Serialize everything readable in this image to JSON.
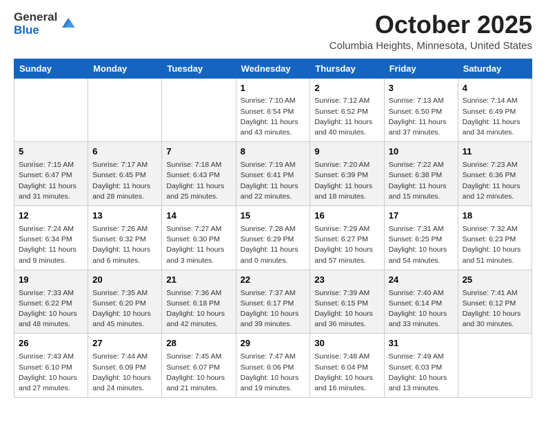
{
  "header": {
    "logo_general": "General",
    "logo_blue": "Blue",
    "month": "October 2025",
    "location": "Columbia Heights, Minnesota, United States"
  },
  "days_of_week": [
    "Sunday",
    "Monday",
    "Tuesday",
    "Wednesday",
    "Thursday",
    "Friday",
    "Saturday"
  ],
  "weeks": [
    [
      {
        "day": "",
        "info": ""
      },
      {
        "day": "",
        "info": ""
      },
      {
        "day": "",
        "info": ""
      },
      {
        "day": "1",
        "info": "Sunrise: 7:10 AM\nSunset: 6:54 PM\nDaylight: 11 hours and 43 minutes."
      },
      {
        "day": "2",
        "info": "Sunrise: 7:12 AM\nSunset: 6:52 PM\nDaylight: 11 hours and 40 minutes."
      },
      {
        "day": "3",
        "info": "Sunrise: 7:13 AM\nSunset: 6:50 PM\nDaylight: 11 hours and 37 minutes."
      },
      {
        "day": "4",
        "info": "Sunrise: 7:14 AM\nSunset: 6:49 PM\nDaylight: 11 hours and 34 minutes."
      }
    ],
    [
      {
        "day": "5",
        "info": "Sunrise: 7:15 AM\nSunset: 6:47 PM\nDaylight: 11 hours and 31 minutes."
      },
      {
        "day": "6",
        "info": "Sunrise: 7:17 AM\nSunset: 6:45 PM\nDaylight: 11 hours and 28 minutes."
      },
      {
        "day": "7",
        "info": "Sunrise: 7:18 AM\nSunset: 6:43 PM\nDaylight: 11 hours and 25 minutes."
      },
      {
        "day": "8",
        "info": "Sunrise: 7:19 AM\nSunset: 6:41 PM\nDaylight: 11 hours and 22 minutes."
      },
      {
        "day": "9",
        "info": "Sunrise: 7:20 AM\nSunset: 6:39 PM\nDaylight: 11 hours and 18 minutes."
      },
      {
        "day": "10",
        "info": "Sunrise: 7:22 AM\nSunset: 6:38 PM\nDaylight: 11 hours and 15 minutes."
      },
      {
        "day": "11",
        "info": "Sunrise: 7:23 AM\nSunset: 6:36 PM\nDaylight: 11 hours and 12 minutes."
      }
    ],
    [
      {
        "day": "12",
        "info": "Sunrise: 7:24 AM\nSunset: 6:34 PM\nDaylight: 11 hours and 9 minutes."
      },
      {
        "day": "13",
        "info": "Sunrise: 7:26 AM\nSunset: 6:32 PM\nDaylight: 11 hours and 6 minutes."
      },
      {
        "day": "14",
        "info": "Sunrise: 7:27 AM\nSunset: 6:30 PM\nDaylight: 11 hours and 3 minutes."
      },
      {
        "day": "15",
        "info": "Sunrise: 7:28 AM\nSunset: 6:29 PM\nDaylight: 11 hours and 0 minutes."
      },
      {
        "day": "16",
        "info": "Sunrise: 7:29 AM\nSunset: 6:27 PM\nDaylight: 10 hours and 57 minutes."
      },
      {
        "day": "17",
        "info": "Sunrise: 7:31 AM\nSunset: 6:25 PM\nDaylight: 10 hours and 54 minutes."
      },
      {
        "day": "18",
        "info": "Sunrise: 7:32 AM\nSunset: 6:23 PM\nDaylight: 10 hours and 51 minutes."
      }
    ],
    [
      {
        "day": "19",
        "info": "Sunrise: 7:33 AM\nSunset: 6:22 PM\nDaylight: 10 hours and 48 minutes."
      },
      {
        "day": "20",
        "info": "Sunrise: 7:35 AM\nSunset: 6:20 PM\nDaylight: 10 hours and 45 minutes."
      },
      {
        "day": "21",
        "info": "Sunrise: 7:36 AM\nSunset: 6:18 PM\nDaylight: 10 hours and 42 minutes."
      },
      {
        "day": "22",
        "info": "Sunrise: 7:37 AM\nSunset: 6:17 PM\nDaylight: 10 hours and 39 minutes."
      },
      {
        "day": "23",
        "info": "Sunrise: 7:39 AM\nSunset: 6:15 PM\nDaylight: 10 hours and 36 minutes."
      },
      {
        "day": "24",
        "info": "Sunrise: 7:40 AM\nSunset: 6:14 PM\nDaylight: 10 hours and 33 minutes."
      },
      {
        "day": "25",
        "info": "Sunrise: 7:41 AM\nSunset: 6:12 PM\nDaylight: 10 hours and 30 minutes."
      }
    ],
    [
      {
        "day": "26",
        "info": "Sunrise: 7:43 AM\nSunset: 6:10 PM\nDaylight: 10 hours and 27 minutes."
      },
      {
        "day": "27",
        "info": "Sunrise: 7:44 AM\nSunset: 6:09 PM\nDaylight: 10 hours and 24 minutes."
      },
      {
        "day": "28",
        "info": "Sunrise: 7:45 AM\nSunset: 6:07 PM\nDaylight: 10 hours and 21 minutes."
      },
      {
        "day": "29",
        "info": "Sunrise: 7:47 AM\nSunset: 6:06 PM\nDaylight: 10 hours and 19 minutes."
      },
      {
        "day": "30",
        "info": "Sunrise: 7:48 AM\nSunset: 6:04 PM\nDaylight: 10 hours and 16 minutes."
      },
      {
        "day": "31",
        "info": "Sunrise: 7:49 AM\nSunset: 6:03 PM\nDaylight: 10 hours and 13 minutes."
      },
      {
        "day": "",
        "info": ""
      }
    ]
  ]
}
